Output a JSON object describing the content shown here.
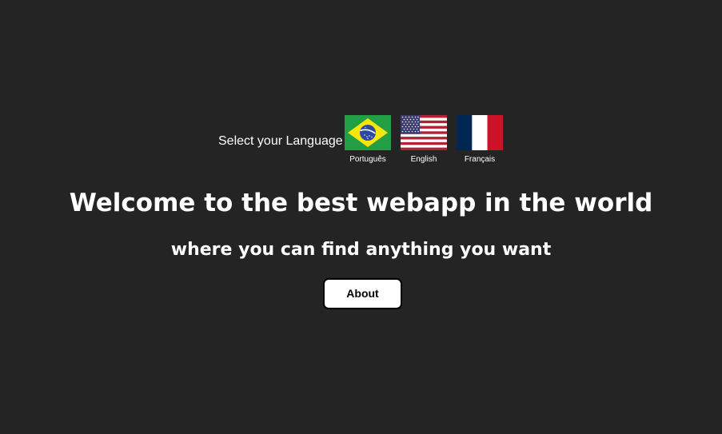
{
  "language_selector": {
    "label": "Select your Language",
    "options": [
      {
        "label": "Português",
        "flag": "brazil-flag-icon"
      },
      {
        "label": "English",
        "flag": "usa-flag-icon"
      },
      {
        "label": "Français",
        "flag": "france-flag-icon"
      }
    ]
  },
  "hero": {
    "title": "Welcome to the best webapp in the world",
    "subtitle": "where you can find anything you want"
  },
  "actions": {
    "about_label": "About"
  },
  "colors": {
    "background": "#242424",
    "text": "#ffffff",
    "button_bg": "#ffffff",
    "button_border": "#000000"
  }
}
